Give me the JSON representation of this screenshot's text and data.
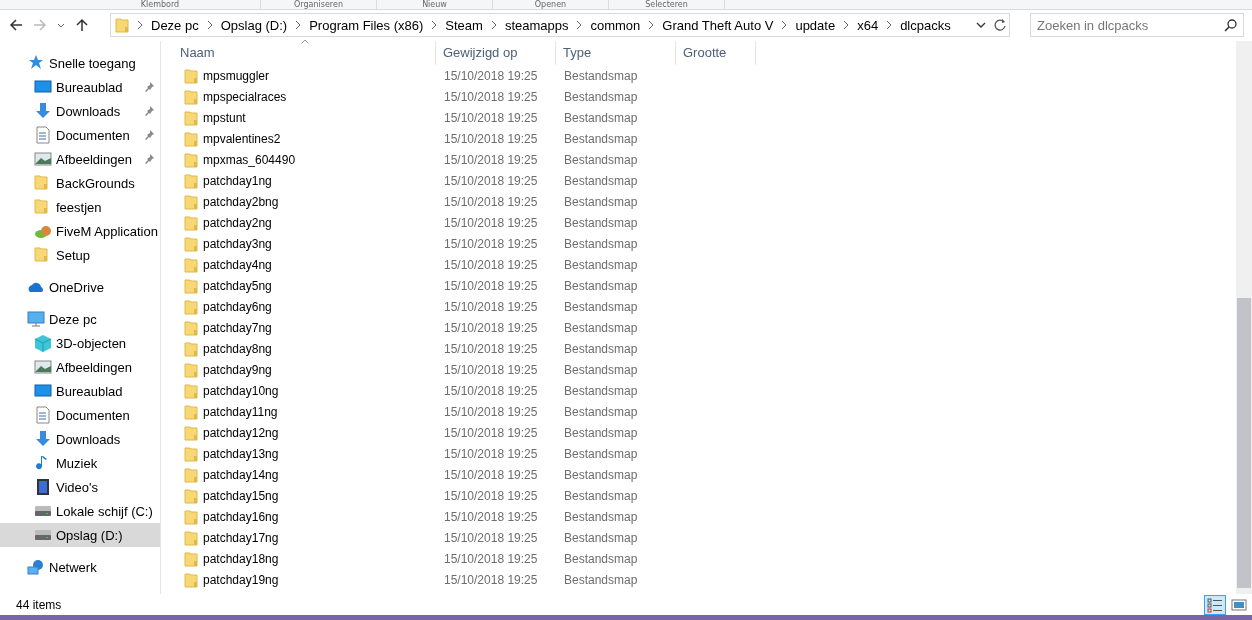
{
  "ribbon_groups": [
    "Klembord",
    "Organiseren",
    "Nieuw",
    "Openen",
    "Selecteren"
  ],
  "address_bar": {
    "segments": [
      "Deze pc",
      "Opslag (D:)",
      "Program Files (x86)",
      "Steam",
      "steamapps",
      "common",
      "Grand Theft Auto V",
      "update",
      "x64",
      "dlcpacks"
    ]
  },
  "search": {
    "placeholder": "Zoeken in dlcpacks"
  },
  "navigation": [
    {
      "label": "Snelle toegang",
      "kind": "star",
      "selected": false,
      "children": [
        {
          "label": "Bureaublad",
          "kind": "desktop",
          "pinned": true,
          "selected": false
        },
        {
          "label": "Downloads",
          "kind": "download",
          "pinned": true,
          "selected": false
        },
        {
          "label": "Documenten",
          "kind": "document",
          "pinned": true,
          "selected": false
        },
        {
          "label": "Afbeeldingen",
          "kind": "picture",
          "pinned": true,
          "selected": false
        },
        {
          "label": "BackGrounds",
          "kind": "folder",
          "pinned": false,
          "selected": false
        },
        {
          "label": "feestjen",
          "kind": "folder",
          "pinned": false,
          "selected": false
        },
        {
          "label": "FiveM Application",
          "kind": "app",
          "pinned": false,
          "selected": false
        },
        {
          "label": "Setup",
          "kind": "folder",
          "pinned": false,
          "selected": false
        }
      ]
    },
    {
      "label": "OneDrive",
      "kind": "cloud",
      "selected": false
    },
    {
      "label": "Deze pc",
      "kind": "pc",
      "selected": false,
      "children": [
        {
          "label": "3D-objecten",
          "kind": "cube",
          "selected": false
        },
        {
          "label": "Afbeeldingen",
          "kind": "picture",
          "selected": false
        },
        {
          "label": "Bureaublad",
          "kind": "desktop",
          "selected": false
        },
        {
          "label": "Documenten",
          "kind": "document",
          "selected": false
        },
        {
          "label": "Downloads",
          "kind": "download",
          "selected": false
        },
        {
          "label": "Muziek",
          "kind": "music",
          "selected": false
        },
        {
          "label": "Video's",
          "kind": "video",
          "selected": false
        },
        {
          "label": "Lokale schijf (C:)",
          "kind": "drive",
          "selected": false
        },
        {
          "label": "Opslag (D:)",
          "kind": "drive",
          "selected": true
        }
      ]
    },
    {
      "label": "Netwerk",
      "kind": "network",
      "selected": false
    }
  ],
  "table": {
    "columns": [
      "Naam",
      "Gewijzigd op",
      "Type",
      "Grootte"
    ],
    "rows": [
      [
        "mpsmuggler",
        "15/10/2018 19:25",
        "Bestandsmap"
      ],
      [
        "mpspecialraces",
        "15/10/2018 19:25",
        "Bestandsmap"
      ],
      [
        "mpstunt",
        "15/10/2018 19:25",
        "Bestandsmap"
      ],
      [
        "mpvalentines2",
        "15/10/2018 19:25",
        "Bestandsmap"
      ],
      [
        "mpxmas_604490",
        "15/10/2018 19:25",
        "Bestandsmap"
      ],
      [
        "patchday1ng",
        "15/10/2018 19:25",
        "Bestandsmap"
      ],
      [
        "patchday2bng",
        "15/10/2018 19:25",
        "Bestandsmap"
      ],
      [
        "patchday2ng",
        "15/10/2018 19:25",
        "Bestandsmap"
      ],
      [
        "patchday3ng",
        "15/10/2018 19:25",
        "Bestandsmap"
      ],
      [
        "patchday4ng",
        "15/10/2018 19:25",
        "Bestandsmap"
      ],
      [
        "patchday5ng",
        "15/10/2018 19:25",
        "Bestandsmap"
      ],
      [
        "patchday6ng",
        "15/10/2018 19:25",
        "Bestandsmap"
      ],
      [
        "patchday7ng",
        "15/10/2018 19:25",
        "Bestandsmap"
      ],
      [
        "patchday8ng",
        "15/10/2018 19:25",
        "Bestandsmap"
      ],
      [
        "patchday9ng",
        "15/10/2018 19:25",
        "Bestandsmap"
      ],
      [
        "patchday10ng",
        "15/10/2018 19:25",
        "Bestandsmap"
      ],
      [
        "patchday11ng",
        "15/10/2018 19:25",
        "Bestandsmap"
      ],
      [
        "patchday12ng",
        "15/10/2018 19:25",
        "Bestandsmap"
      ],
      [
        "patchday13ng",
        "15/10/2018 19:25",
        "Bestandsmap"
      ],
      [
        "patchday14ng",
        "15/10/2018 19:25",
        "Bestandsmap"
      ],
      [
        "patchday15ng",
        "15/10/2018 19:25",
        "Bestandsmap"
      ],
      [
        "patchday16ng",
        "15/10/2018 19:25",
        "Bestandsmap"
      ],
      [
        "patchday17ng",
        "15/10/2018 19:25",
        "Bestandsmap"
      ],
      [
        "patchday18ng",
        "15/10/2018 19:25",
        "Bestandsmap"
      ],
      [
        "patchday19ng",
        "15/10/2018 19:25",
        "Bestandsmap"
      ]
    ]
  },
  "status_bar": {
    "count": "44 items"
  },
  "view_buttons": [
    {
      "kind": "details",
      "selected": true
    },
    {
      "kind": "large-icons",
      "selected": false
    }
  ]
}
